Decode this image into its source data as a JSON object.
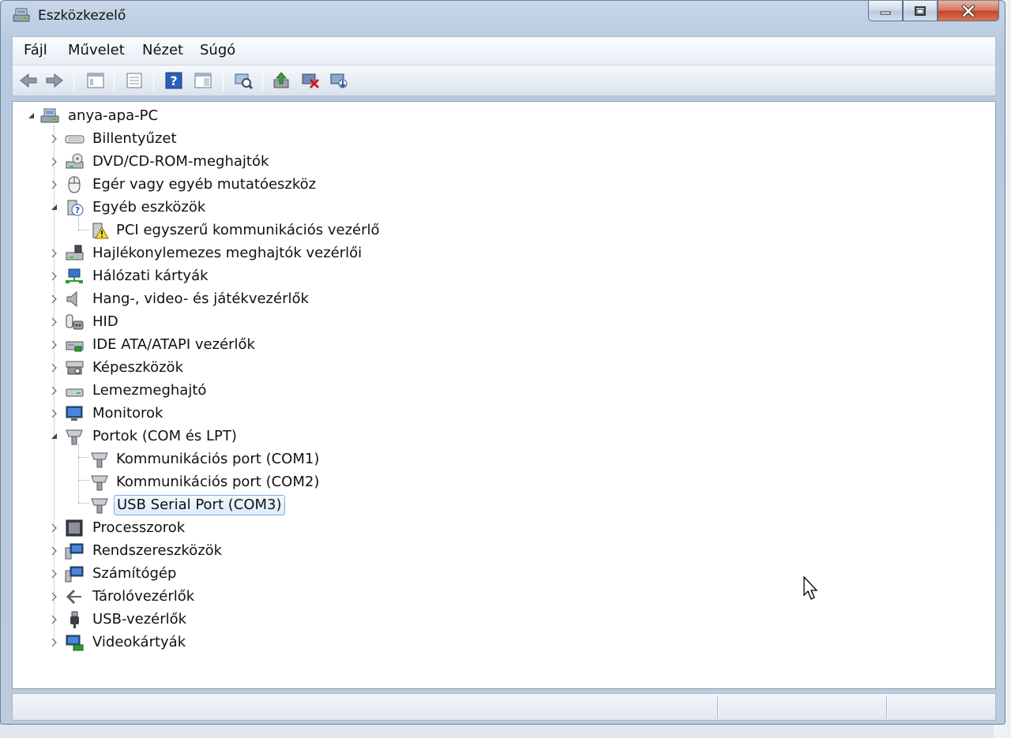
{
  "window": {
    "title": "Eszközkezelő"
  },
  "menu": [
    "Fájl",
    "Művelet",
    "Nézet",
    "Súgó"
  ],
  "toolbar": [
    {
      "name": "back-icon"
    },
    {
      "name": "forward-icon"
    },
    {
      "name": "show-hide-tree-icon"
    },
    {
      "name": "properties-icon"
    },
    {
      "name": "help-icon"
    },
    {
      "name": "action-pane-icon"
    },
    {
      "name": "scan-hardware-icon"
    },
    {
      "name": "update-driver-icon"
    },
    {
      "name": "uninstall-device-icon"
    },
    {
      "name": "disable-device-icon"
    }
  ],
  "tree": {
    "root": "anya-apa-PC",
    "items": [
      {
        "label": "Billentyűzet",
        "icon": "keyboard-icon",
        "expanded": false
      },
      {
        "label": "DVD/CD-ROM-meghajtók",
        "icon": "dvd-drive-icon",
        "expanded": false
      },
      {
        "label": "Egér vagy egyéb mutatóeszköz",
        "icon": "mouse-icon",
        "expanded": false
      },
      {
        "label": "Egyéb eszközök",
        "icon": "unknown-device-icon",
        "expanded": true,
        "children": [
          {
            "label": "PCI egyszerű kommunikációs vezérlő",
            "icon": "warning-device-icon"
          }
        ]
      },
      {
        "label": "Hajlékonylemezes meghajtók vezérlői",
        "icon": "floppy-controller-icon",
        "expanded": false
      },
      {
        "label": "Hálózati kártyák",
        "icon": "network-adapter-icon",
        "expanded": false
      },
      {
        "label": "Hang-, video- és játékvezérlők",
        "icon": "speaker-icon",
        "expanded": false
      },
      {
        "label": "HID",
        "icon": "hid-icon",
        "expanded": false
      },
      {
        "label": "IDE ATA/ATAPI vezérlők",
        "icon": "ide-controller-icon",
        "expanded": false
      },
      {
        "label": "Képeszközök",
        "icon": "imaging-device-icon",
        "expanded": false
      },
      {
        "label": "Lemezmeghajtó",
        "icon": "disk-drive-icon",
        "expanded": false
      },
      {
        "label": "Monitorok",
        "icon": "monitor-icon",
        "expanded": false
      },
      {
        "label": "Portok (COM és LPT)",
        "icon": "port-icon",
        "expanded": true,
        "children": [
          {
            "label": "Kommunikációs port (COM1)",
            "icon": "port-icon"
          },
          {
            "label": "Kommunikációs port (COM2)",
            "icon": "port-icon"
          },
          {
            "label": "USB Serial Port (COM3)",
            "icon": "port-icon",
            "selected": true
          }
        ]
      },
      {
        "label": "Processzorok",
        "icon": "processor-icon",
        "expanded": false
      },
      {
        "label": "Rendszereszközök",
        "icon": "system-devices-icon",
        "expanded": false
      },
      {
        "label": "Számítógép",
        "icon": "computer-icon",
        "expanded": false
      },
      {
        "label": "Tárolóvezérlők",
        "icon": "storage-controller-icon",
        "expanded": false
      },
      {
        "label": "USB-vezérlők",
        "icon": "usb-icon",
        "expanded": false
      },
      {
        "label": "Videokártyák",
        "icon": "display-adapter-icon",
        "expanded": false
      }
    ]
  },
  "colors": {
    "selection_border": "#84acdd",
    "window_frame": "#b7c9df",
    "close_button": "#c2432a"
  }
}
